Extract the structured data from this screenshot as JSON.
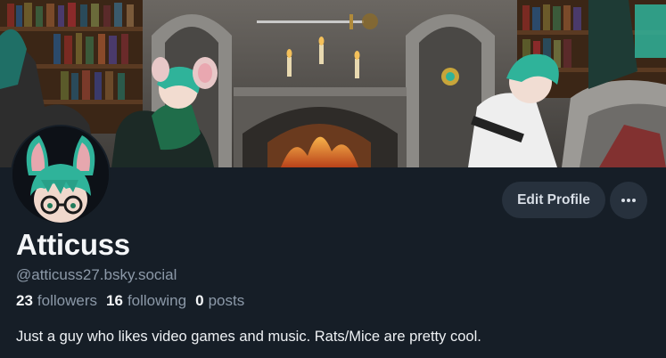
{
  "profile": {
    "display_name": "Atticuss",
    "handle": "@atticuss27.bsky.social",
    "bio": "Just a guy who likes video games and music. Rats/Mice are pretty cool.",
    "stats": {
      "followers_count": "23",
      "followers_label": "followers",
      "following_count": "16",
      "following_label": "following",
      "posts_count": "0",
      "posts_label": "posts"
    }
  },
  "actions": {
    "edit_profile_label": "Edit Profile",
    "more_icon": "ellipsis-icon"
  },
  "colors": {
    "background": "#161e27",
    "button_bg": "#27313d",
    "muted_text": "#8c99a8",
    "avatar_accent": "#2fb39a"
  }
}
